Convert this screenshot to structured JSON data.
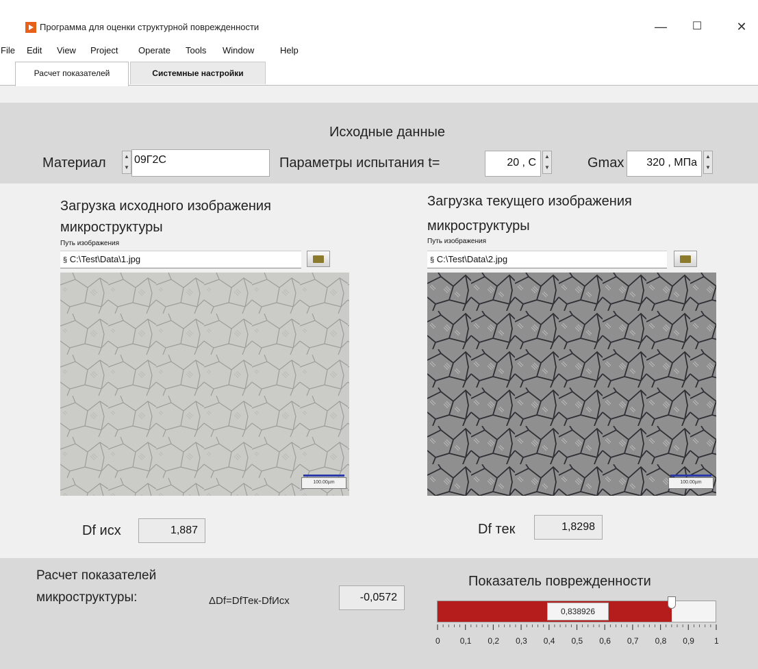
{
  "window": {
    "title": "Программа для оценки структурной поврежденности",
    "minimize_glyph": "—",
    "maximize_glyph": "☐",
    "close_glyph": "✕"
  },
  "menu": [
    "File",
    "Edit",
    "View",
    "Project",
    "Operate",
    "Tools",
    "Window",
    "Help"
  ],
  "tabs": [
    "Расчет показателей",
    "Системные настройки"
  ],
  "input": {
    "title": "Исходные данные",
    "material_label": "Материал",
    "material_value": "09Г2С",
    "test_params_label": "Параметры испытания t=",
    "temperature_value": "20 , C",
    "gmax_label": "Gmax",
    "gmax_value": "320 , МПа"
  },
  "source_image": {
    "title_line1": "Загрузка исходного изображения",
    "title_line2": "микроструктуры",
    "path_label": "Путь изображения",
    "path_value": "C:\\Test\\Data\\1.jpg",
    "scale_label": "100.00µm"
  },
  "current_image": {
    "title_line1": "Загрузка текущего изображения",
    "title_line2": "микроструктуры",
    "path_label": "Путь изображения",
    "path_value": "C:\\Test\\Data\\2.jpg",
    "scale_label": "100.00µm"
  },
  "df_source": {
    "label": "Df исх",
    "value": "1,887"
  },
  "df_current": {
    "label": "Df тек",
    "value": "1,8298"
  },
  "results": {
    "label_line1": "Расчет показателей",
    "label_line2": "микроструктуры:",
    "formula": "ΔDf=DfТек-DfИсх",
    "delta_value": "-0,0572",
    "damage_title": "Показатель поврежденности",
    "damage_value": 0.838926,
    "damage_value_text": "0,838926",
    "scale_ticks": [
      "0",
      "0,1",
      "0,2",
      "0,3",
      "0,4",
      "0,5",
      "0,6",
      "0,7",
      "0,8",
      "0,9",
      "1"
    ]
  },
  "icons": {
    "app": "labview-run-icon",
    "path_prefix": "path-icon",
    "browse": "folder-open-icon"
  },
  "colors": {
    "damage_fill": "#b51c1c",
    "panel_bg": "#d9d9d9"
  }
}
